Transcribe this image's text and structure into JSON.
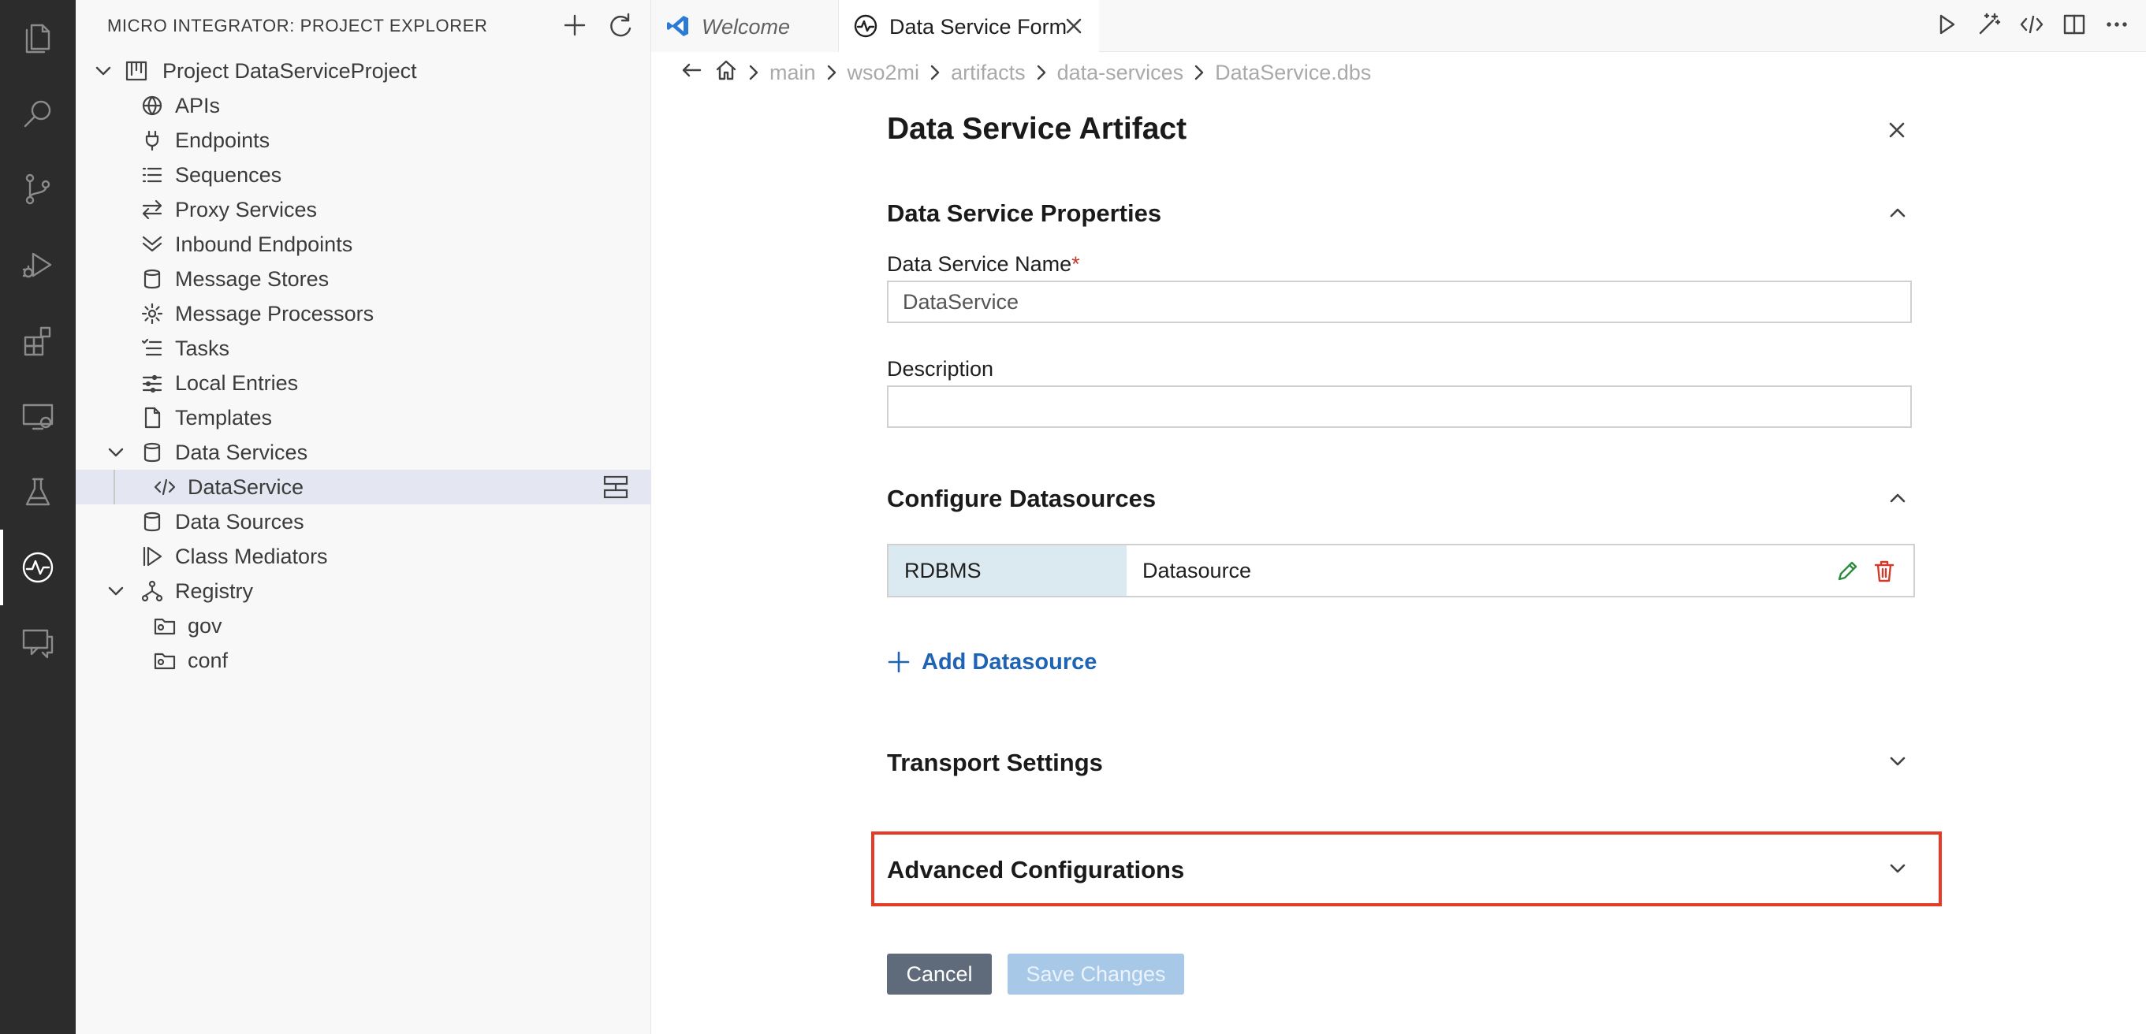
{
  "sidebar": {
    "title": "MICRO INTEGRATOR: PROJECT EXPLORER",
    "items": [
      {
        "label": "Project DataServiceProject"
      },
      {
        "label": "APIs"
      },
      {
        "label": "Endpoints"
      },
      {
        "label": "Sequences"
      },
      {
        "label": "Proxy Services"
      },
      {
        "label": "Inbound Endpoints"
      },
      {
        "label": "Message Stores"
      },
      {
        "label": "Message Processors"
      },
      {
        "label": "Tasks"
      },
      {
        "label": "Local Entries"
      },
      {
        "label": "Templates"
      },
      {
        "label": "Data Services"
      },
      {
        "label": "DataService"
      },
      {
        "label": "Data Sources"
      },
      {
        "label": "Class Mediators"
      },
      {
        "label": "Registry"
      },
      {
        "label": "gov"
      },
      {
        "label": "conf"
      }
    ]
  },
  "tabs": [
    {
      "label": "Welcome"
    },
    {
      "label": "Data Service Form"
    }
  ],
  "breadcrumb": [
    "main",
    "wso2mi",
    "artifacts",
    "data-services",
    "DataService.dbs"
  ],
  "form": {
    "title": "Data Service Artifact",
    "properties": {
      "title": "Data Service Properties",
      "name_label": "Data Service Name",
      "required_mark": "*",
      "name_value": "DataService",
      "description_label": "Description",
      "description_value": ""
    },
    "datasources": {
      "title": "Configure Datasources",
      "rows": [
        {
          "type": "RDBMS",
          "name": "Datasource"
        }
      ],
      "add_label": "Add Datasource"
    },
    "transport": {
      "title": "Transport Settings"
    },
    "advanced": {
      "title": "Advanced Configurations"
    },
    "cancel_label": "Cancel",
    "save_label": "Save Changes"
  },
  "colors": {
    "activity_bar": "#2c2c2c",
    "accent_link": "#1f63b5",
    "highlight_border": "#e53a25",
    "datasource_type_bg": "#dbe9f1",
    "cancel_bg": "#5f6b7a",
    "save_bg_disabled": "#a8c8e8"
  }
}
